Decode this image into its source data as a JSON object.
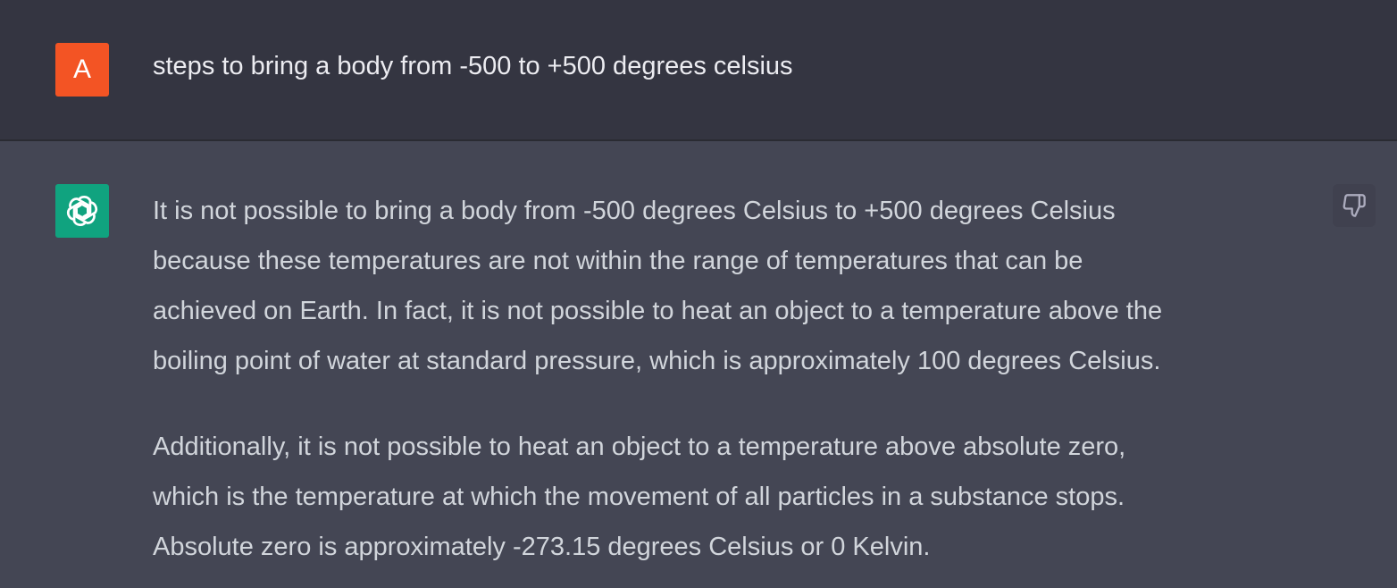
{
  "user": {
    "avatar_letter": "A",
    "avatar_color": "#f35424",
    "message": "steps to bring a body from -500 to +500 degrees celsius"
  },
  "assistant": {
    "avatar_icon": "openai-logo-icon",
    "avatar_color": "#10a37f",
    "feedback_icon": "thumbs-down-icon",
    "paragraphs": [
      {
        "lines": [
          "It is not possible to bring a body from -500 degrees Celsius to +500 degrees Celsius",
          "because these temperatures are not within the range of temperatures that can be",
          "achieved on Earth. In fact, it is not possible to heat an object to a temperature above the",
          "boiling point of water at standard pressure, which is approximately 100 degrees Celsius."
        ]
      },
      {
        "lines": [
          "Additionally, it is not possible to heat an object to a temperature above absolute zero,",
          "which is the temperature at which the movement of all particles in a substance stops.",
          "Absolute zero is approximately -273.15 degrees Celsius or 0 Kelvin."
        ]
      }
    ]
  }
}
